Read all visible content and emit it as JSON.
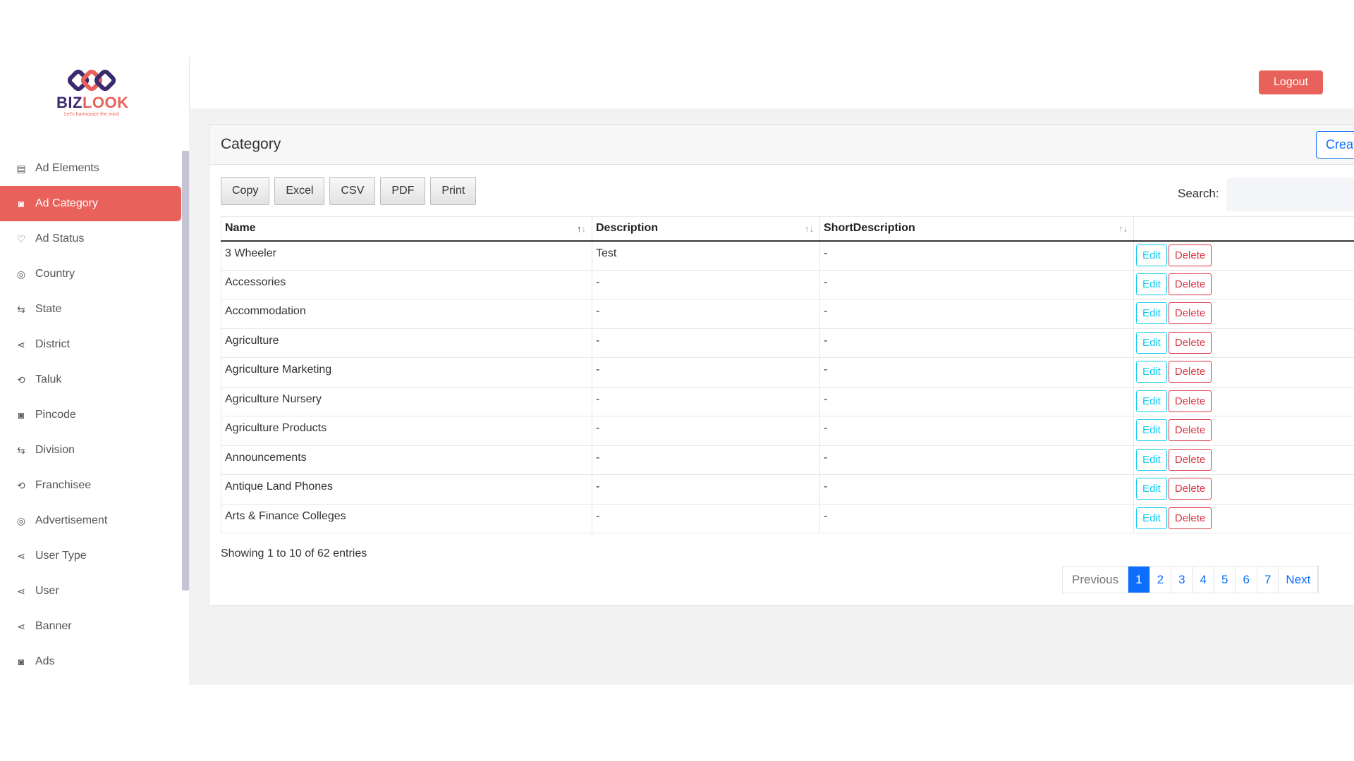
{
  "brand": {
    "name_part1": "BIZ",
    "name_part2": "LOOK",
    "tagline": "Let's harmonize the mind",
    "colors": {
      "primary": "#3b2a6e",
      "accent": "#e8615a"
    }
  },
  "header": {
    "logout_label": "Logout"
  },
  "sidebar": {
    "active": "Ad Category",
    "items": [
      {
        "label": "Ad Elements",
        "icon": "clipboard-icon"
      },
      {
        "label": "Ad Category",
        "icon": "bookmark-box-icon"
      },
      {
        "label": "Ad Status",
        "icon": "heart-icon"
      },
      {
        "label": "Country",
        "icon": "user-circle-icon"
      },
      {
        "label": "State",
        "icon": "arrows-exchange-icon"
      },
      {
        "label": "District",
        "icon": "share-icon"
      },
      {
        "label": "Taluk",
        "icon": "repeat-icon"
      },
      {
        "label": "Pincode",
        "icon": "bookmark-box-icon"
      },
      {
        "label": "Division",
        "icon": "arrows-exchange-icon"
      },
      {
        "label": "Franchisee",
        "icon": "repeat-icon"
      },
      {
        "label": "Advertisement",
        "icon": "user-circle-icon"
      },
      {
        "label": "User Type",
        "icon": "share-icon"
      },
      {
        "label": "User",
        "icon": "share-icon"
      },
      {
        "label": "Banner",
        "icon": "share-icon"
      },
      {
        "label": "Ads",
        "icon": "bookmark-box-icon"
      }
    ]
  },
  "page": {
    "title": "Category",
    "create_label": "Create",
    "export_buttons": [
      "Copy",
      "Excel",
      "CSV",
      "PDF",
      "Print"
    ],
    "search_label": "Search:",
    "search_value": "",
    "columns": [
      "Name",
      "Description",
      "ShortDescription"
    ],
    "edit_label": "Edit",
    "delete_label": "Delete",
    "rows": [
      {
        "name": "3 Wheeler",
        "description": "Test",
        "short": "-"
      },
      {
        "name": "Accessories",
        "description": "-",
        "short": "-"
      },
      {
        "name": "Accommodation",
        "description": "-",
        "short": "-"
      },
      {
        "name": "Agriculture",
        "description": "-",
        "short": "-"
      },
      {
        "name": "Agriculture Marketing",
        "description": "-",
        "short": "-"
      },
      {
        "name": "Agriculture Nursery",
        "description": "-",
        "short": "-"
      },
      {
        "name": "Agriculture Products",
        "description": "-",
        "short": "-"
      },
      {
        "name": "Announcements",
        "description": "-",
        "short": "-"
      },
      {
        "name": "Antique Land Phones",
        "description": "-",
        "short": "-"
      },
      {
        "name": "Arts & Finance Colleges",
        "description": "-",
        "short": "-"
      }
    ],
    "info": "Showing 1 to 10 of 62 entries",
    "pagination": {
      "previous": "Previous",
      "pages": [
        "1",
        "2",
        "3",
        "4",
        "5",
        "6",
        "7"
      ],
      "current": "1",
      "next": "Next"
    }
  }
}
